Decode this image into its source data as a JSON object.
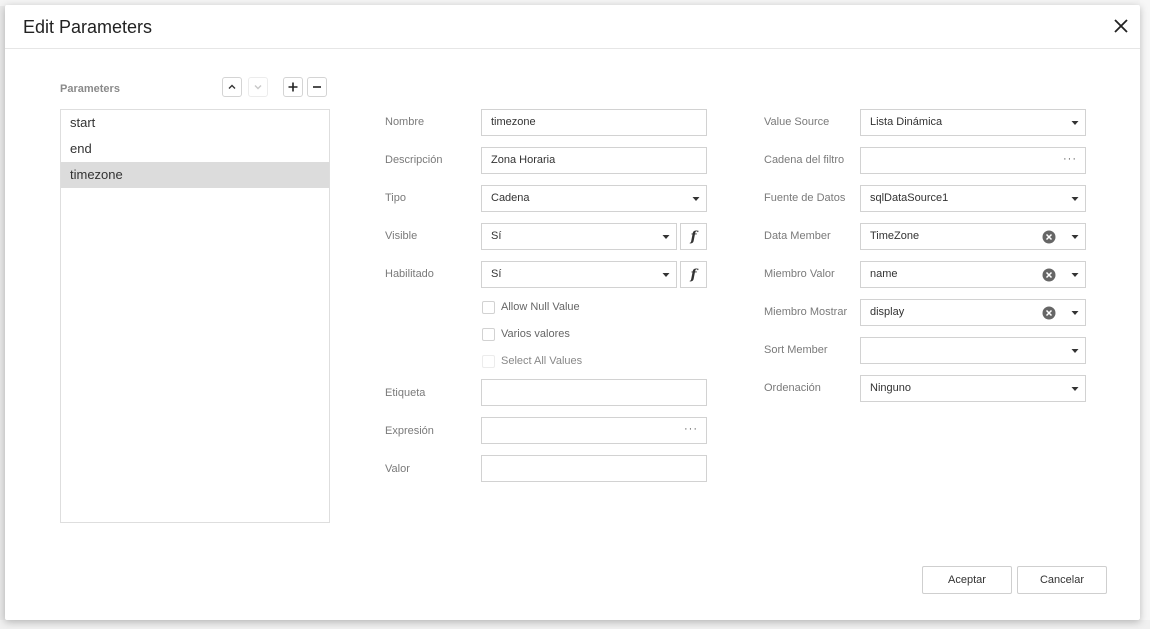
{
  "dialog": {
    "title": "Edit Parameters"
  },
  "parameters": {
    "caption": "Parameters",
    "items": [
      {
        "label": "start",
        "selected": false
      },
      {
        "label": "end",
        "selected": false
      },
      {
        "label": "timezone",
        "selected": true
      }
    ]
  },
  "form": {
    "nombre": {
      "label": "Nombre",
      "value": "timezone"
    },
    "descripcion": {
      "label": "Descripción",
      "value": "Zona Horaria"
    },
    "tipo": {
      "label": "Tipo",
      "value": "Cadena"
    },
    "visible": {
      "label": "Visible",
      "value": "Sí"
    },
    "habilitado": {
      "label": "Habilitado",
      "value": "Sí"
    },
    "allow_null": {
      "label": "Allow Null Value",
      "checked": false
    },
    "varios_valores": {
      "label": "Varios valores",
      "checked": false
    },
    "select_all": {
      "label": "Select All Values",
      "checked": false
    },
    "etiqueta": {
      "label": "Etiqueta",
      "value": ""
    },
    "expresion": {
      "label": "Expresión",
      "value": ""
    },
    "valor": {
      "label": "Valor",
      "value": ""
    },
    "value_source": {
      "label": "Value Source",
      "value": "Lista Dinámica"
    },
    "cadena_filtro": {
      "label": "Cadena del filtro",
      "value": ""
    },
    "fuente_datos": {
      "label": "Fuente de Datos",
      "value": "sqlDataSource1"
    },
    "data_member": {
      "label": "Data Member",
      "value": "TimeZone"
    },
    "miembro_valor": {
      "label": "Miembro Valor",
      "value": "name"
    },
    "miembro_mostrar": {
      "label": "Miembro Mostrar",
      "value": "display"
    },
    "sort_member": {
      "label": "Sort Member",
      "value": ""
    },
    "ordenacion": {
      "label": "Ordenación",
      "value": "Ninguno"
    },
    "ellipsis": "···"
  },
  "buttons": {
    "accept": "Aceptar",
    "cancel": "Cancelar"
  },
  "icons": {
    "close": "close-icon",
    "move_up": "chevron-up-icon",
    "move_down": "chevron-down-icon",
    "add": "plus-icon",
    "remove": "minus-icon",
    "dropdown": "caret-down-icon",
    "clear": "clear-circle-icon",
    "function": "function-icon"
  }
}
